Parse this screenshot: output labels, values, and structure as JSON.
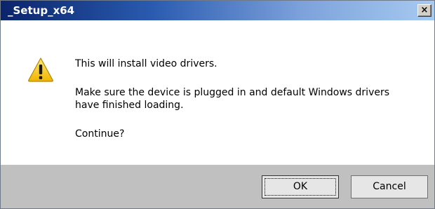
{
  "window": {
    "title": "_Setup_x64",
    "close_label": "×"
  },
  "message": {
    "icon": "warning-icon",
    "line1": "This will install video drivers.",
    "line2": "Make sure the device is plugged in and default Windows drivers",
    "line3": "have finished loading.",
    "line4": "Continue?"
  },
  "buttons": {
    "ok_label": "OK",
    "cancel_label": "Cancel"
  },
  "colors": {
    "titlebar_start": "#0a246a",
    "titlebar_end": "#a6caf0",
    "footer_bg": "#c0c0c0",
    "warning_yellow": "#f5c400"
  }
}
